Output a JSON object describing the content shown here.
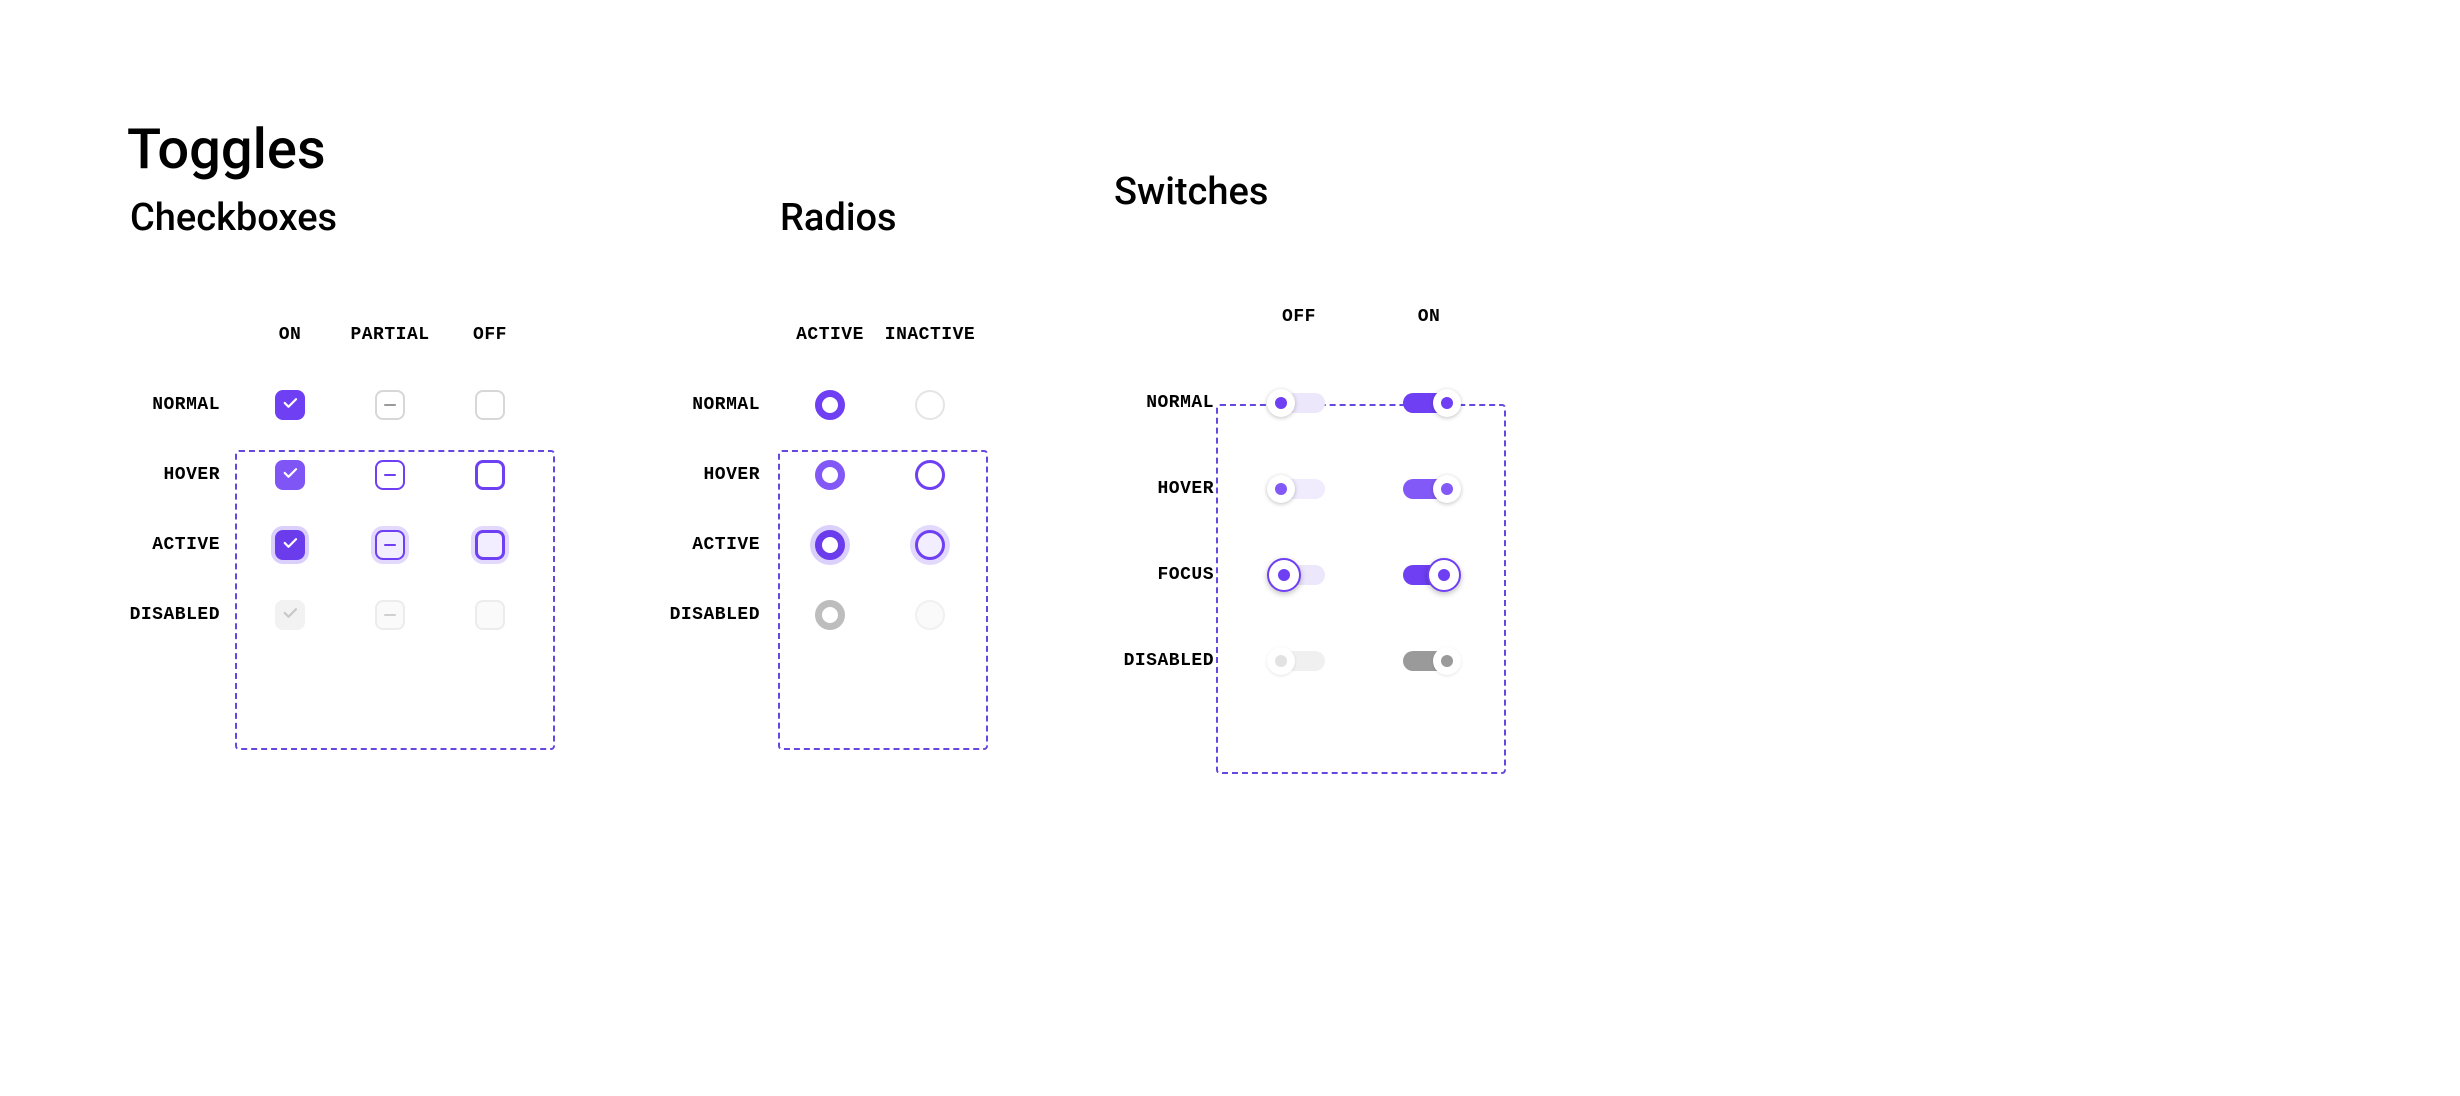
{
  "colors": {
    "accent": "#6e3ff3",
    "accent_hover": "#8259f6",
    "accent_light": "#ece7fb",
    "disabled_gray": "#9a9a9a",
    "border_dashed": "#6648e1"
  },
  "page_title": "Toggles",
  "checkboxes": {
    "title": "Checkboxes",
    "col_labels": {
      "on": "ON",
      "partial": "PARTIAL",
      "off": "OFF"
    },
    "row_labels": {
      "normal": "NORMAL",
      "hover": "HOVER",
      "active": "ACTIVE",
      "disabled": "DISABLED"
    }
  },
  "radios": {
    "title": "Radios",
    "col_labels": {
      "active": "ACTIVE",
      "inactive": "INACTIVE"
    },
    "row_labels": {
      "normal": "NORMAL",
      "hover": "HOVER",
      "active": "ACTIVE",
      "disabled": "DISABLED"
    }
  },
  "switches": {
    "title": "Switches",
    "col_labels": {
      "off": "OFF",
      "on": "ON"
    },
    "row_labels": {
      "normal": "NORMAL",
      "hover": "HOVER",
      "focus": "FOCUS",
      "disabled": "DISABLED"
    }
  }
}
